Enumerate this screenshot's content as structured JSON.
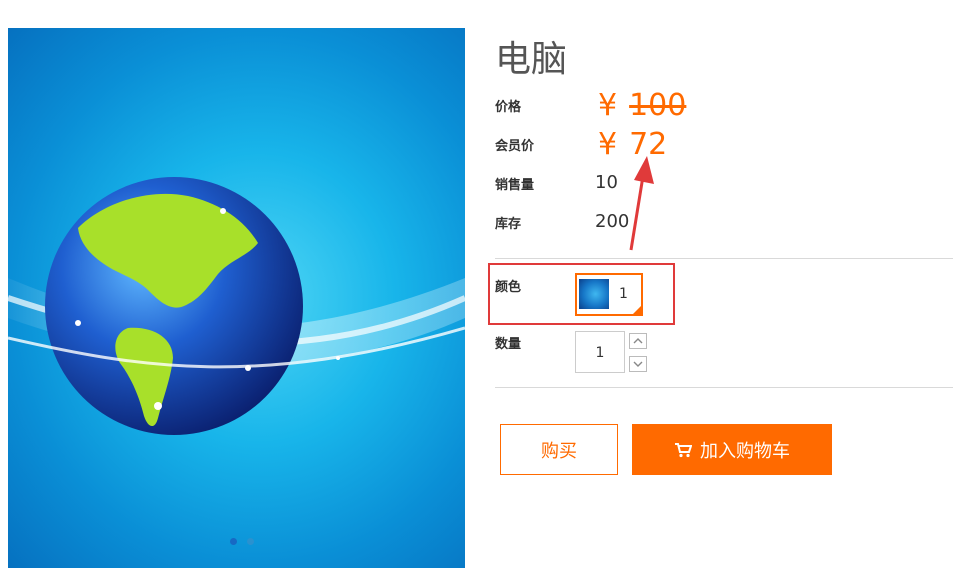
{
  "product": {
    "title": "电脑",
    "gallery": {
      "image_icon": "earth-globe-image",
      "slides": 2,
      "active_slide": 1
    },
    "price": {
      "label": "价格",
      "currency": "¥",
      "value": "100"
    },
    "member_price": {
      "label": "会员价",
      "currency": "¥",
      "value": "72"
    },
    "sales": {
      "label": "销售量",
      "value": "10"
    },
    "stock": {
      "label": "库存",
      "value": "200"
    },
    "color": {
      "label": "颜色",
      "option_value": "1",
      "option_icon": "color-thumbnail"
    },
    "quantity": {
      "label": "数量",
      "value": "1"
    },
    "actions": {
      "buy": "购买",
      "add_to_cart": "加入购物车",
      "cart_icon": "cart-icon"
    }
  },
  "colors": {
    "accent": "#ff6a00",
    "annotation": "#e03a3a",
    "divider": "#d9d9d9"
  }
}
